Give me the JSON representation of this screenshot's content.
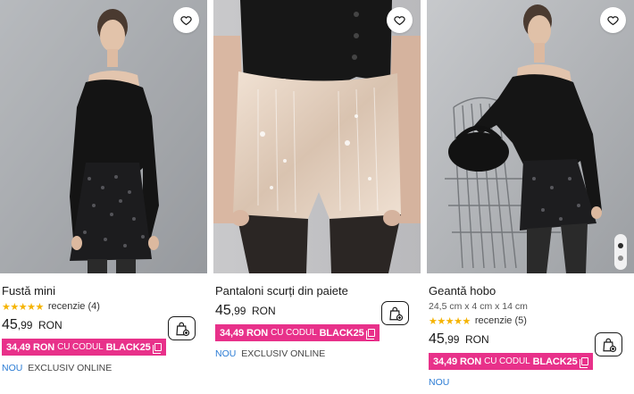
{
  "products": [
    {
      "name": "Fustă mini",
      "rating": {
        "stars": "★★★★★",
        "text": "recenzie (4)"
      },
      "price": {
        "int": "45",
        "dec": ",99",
        "currency": "RON"
      },
      "promo": {
        "price": "34,49 RON",
        "via": "CU CODUL",
        "code": "BLACK25"
      },
      "tags": {
        "new": "NOU",
        "online": "EXCLUSIV ONLINE"
      }
    },
    {
      "name": "Pantaloni scurți din paiete",
      "price": {
        "int": "45",
        "dec": ",99",
        "currency": "RON"
      },
      "promo": {
        "price": "34,49 RON",
        "via": "CU CODUL",
        "code": "BLACK25"
      },
      "tags": {
        "new": "NOU",
        "online": "EXCLUSIV ONLINE"
      }
    },
    {
      "name": "Geantă hobo",
      "dimensions": "24,5 cm x 4 cm x 14 cm",
      "rating": {
        "stars": "★★★★★",
        "text": "recenzie (5)"
      },
      "price": {
        "int": "45",
        "dec": ",99",
        "currency": "RON"
      },
      "promo": {
        "price": "34,49 RON",
        "via": "CU CODUL",
        "code": "BLACK25"
      },
      "tags": {
        "new": "NOU"
      }
    }
  ],
  "colors": {
    "promo": "#e8318a",
    "new_tag": "#2a7bd4",
    "stars": "#f5b301"
  },
  "icons": {
    "favorite": "heart-icon",
    "add_to_cart": "shopping-bag-plus-icon",
    "copy": "copy-icon"
  }
}
